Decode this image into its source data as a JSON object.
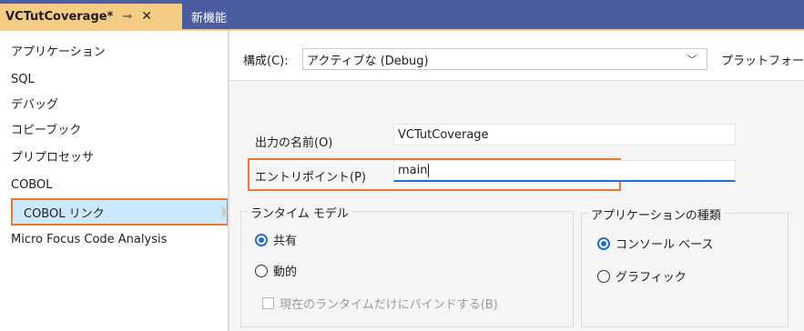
{
  "tabs": {
    "active_title": "VCTutCoverage*",
    "pin_glyph": "⊸",
    "close_glyph": "✕",
    "inactive_title": "新機能"
  },
  "sidebar": {
    "items": [
      {
        "label": "アプリケーション"
      },
      {
        "label": "SQL"
      },
      {
        "label": "デバッグ"
      },
      {
        "label": "コピーブック"
      },
      {
        "label": "プリプロセッサ"
      },
      {
        "label": "COBOL"
      },
      {
        "label": "COBOL リンク"
      },
      {
        "label": "Micro Focus Code Analysis"
      }
    ],
    "selected_index": 6
  },
  "config": {
    "label": "構成(C):",
    "value": "アクティブな (Debug)",
    "platform_label": "プラットフォーム(",
    "chevron_glyph": "﹀"
  },
  "form": {
    "output_name_label": "出力の名前(O)",
    "output_name_value": "VCTutCoverage",
    "entry_point_label": "エントリポイント(P)",
    "entry_point_value": "main"
  },
  "runtime_model": {
    "title": "ランタイム モデル",
    "options": [
      {
        "label": "共有",
        "checked": true
      },
      {
        "label": "動的",
        "checked": false
      }
    ],
    "bind_checkbox_label": "現在のランタイムだけにバインドする(B)"
  },
  "app_type": {
    "title": "アプリケーションの種類",
    "options": [
      {
        "label": "コンソール ベース",
        "checked": true
      },
      {
        "label": "グラフィック",
        "checked": false
      }
    ]
  },
  "colors": {
    "tab_bar": "#4b5da0",
    "active_tab": "#f5cc84",
    "highlight": "#e8782a",
    "accent": "#1f6fd1"
  }
}
